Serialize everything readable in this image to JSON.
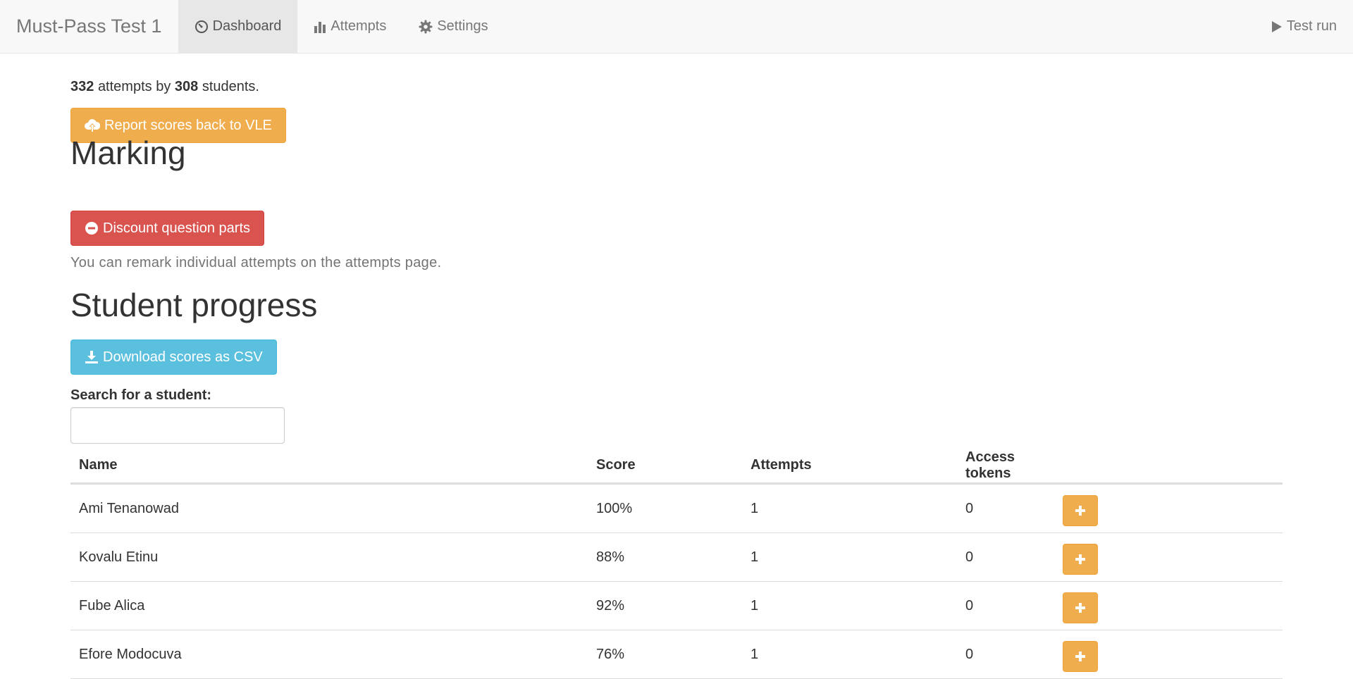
{
  "navbar": {
    "brand": "Must-Pass Test 1",
    "tabs": [
      {
        "label": "Dashboard",
        "icon": "dashboard-icon",
        "active": true
      },
      {
        "label": "Attempts",
        "icon": "bar-chart-icon",
        "active": false
      },
      {
        "label": "Settings",
        "icon": "gear-icon",
        "active": false
      }
    ],
    "test_run": "Test run"
  },
  "summary": {
    "attempts": "332",
    "attempts_text": "attempts by",
    "students": "308",
    "students_text": "students."
  },
  "report_button": "Report scores back to VLE",
  "marking": {
    "heading": "Marking",
    "discount_button": "Discount question parts",
    "help": "You can remark individual attempts on the attempts page."
  },
  "progress": {
    "heading": "Student progress",
    "download_button": "Download scores as CSV",
    "search_label": "Search for a student:",
    "search_value": ""
  },
  "table": {
    "headers": {
      "name": "Name",
      "score": "Score",
      "attempts": "Attempts",
      "tokens": "Access tokens"
    },
    "rows": [
      {
        "name": "Ami Tenanowad",
        "score": "100%",
        "attempts": "1",
        "tokens": "0"
      },
      {
        "name": "Kovalu Etinu",
        "score": "88%",
        "attempts": "1",
        "tokens": "0"
      },
      {
        "name": "Fube Alica",
        "score": "92%",
        "attempts": "1",
        "tokens": "0"
      },
      {
        "name": "Efore Modocuva",
        "score": "76%",
        "attempts": "1",
        "tokens": "0"
      }
    ]
  },
  "colors": {
    "warning": "#f0ad4e",
    "danger": "#d9534f",
    "info": "#5bc0de",
    "navbar_bg": "#f8f8f8"
  }
}
